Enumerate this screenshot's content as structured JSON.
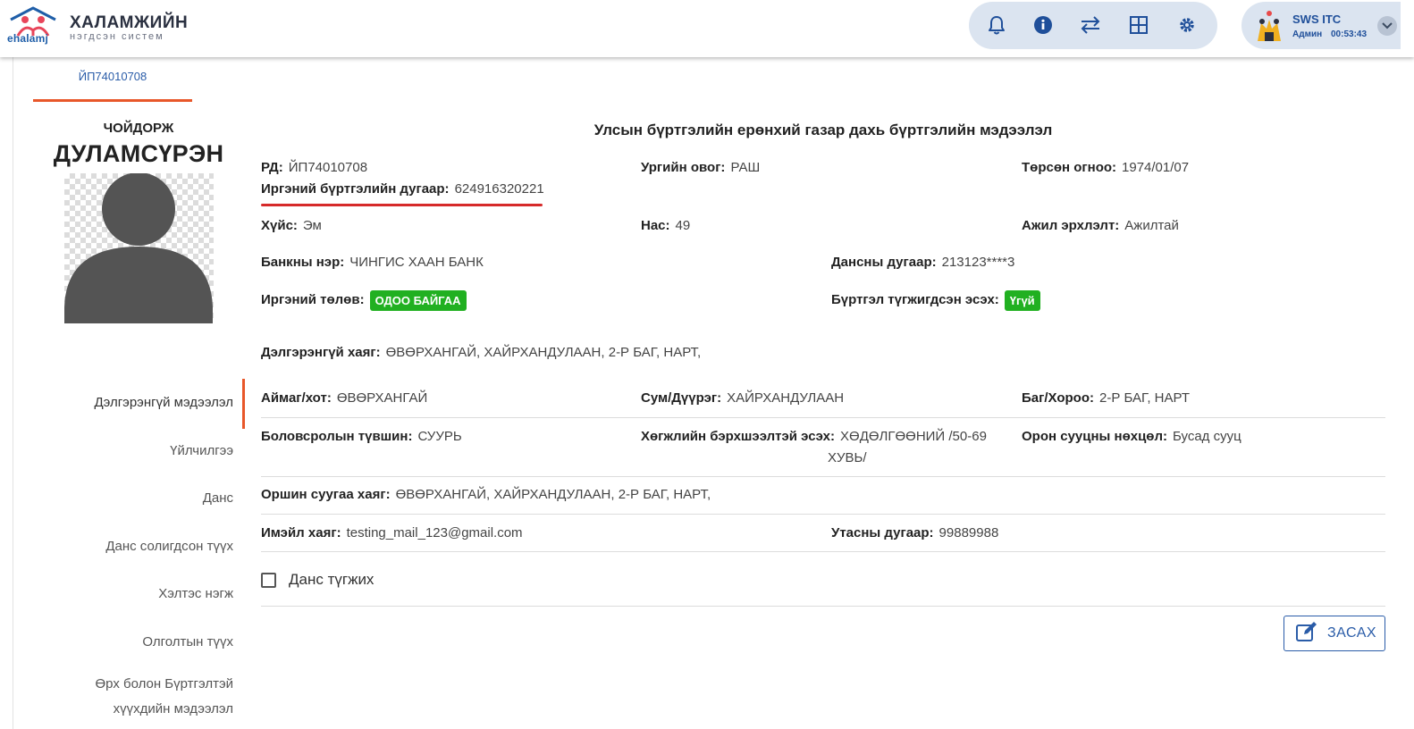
{
  "header": {
    "logo_text": "ehalamj",
    "brand_title": "ХАЛАМЖИЙН",
    "brand_subtitle": "нэгдсэн систем",
    "toolbar_icons": [
      "bell-icon",
      "info-icon",
      "transfer-icon",
      "grid-icon",
      "settings-icon"
    ],
    "user": {
      "name": "SWS ITC",
      "role": "Админ",
      "session_time": "00:53:43"
    },
    "colors": {
      "toolbar_bg": "#dbe4f0",
      "accent": "#1f4f9a"
    }
  },
  "tab": {
    "label": "ЙП74010708",
    "underline_color": "#e8572a"
  },
  "profile": {
    "first_name": "ЧОЙДОРЖ",
    "last_name": "ДУЛАМСҮРЭН"
  },
  "side_nav": {
    "items": [
      {
        "label": "Дэлгэрэнгүй мэдээлэл",
        "active": true
      },
      {
        "label": "Үйлчилгээ"
      },
      {
        "label": "Данс"
      },
      {
        "label": "Данс солигдсон түүх"
      },
      {
        "label": "Хэлтэс нэгж"
      },
      {
        "label": "Олголтын түүх"
      },
      {
        "label": "Өрх болон Бүртгэлтэй"
      },
      {
        "label": "хүүхдийн мэдээлэл"
      }
    ]
  },
  "main": {
    "section_title": "Улсын бүртгэлийн ерөнхий газар дахь бүртгэлийн мэдээлэл",
    "rd": {
      "label": "РД:",
      "value": "ЙП74010708"
    },
    "citizen_reg": {
      "label": "Иргэний бүртгэлийн дугаар:",
      "value": "624916320221"
    },
    "clan": {
      "label": "Ургийн овог:",
      "value": "РАШ"
    },
    "birth_date": {
      "label": "Төрсөн огноо:",
      "value": "1974/01/07"
    },
    "gender": {
      "label": "Хүйс:",
      "value": "Эм"
    },
    "age": {
      "label": "Нас:",
      "value": "49"
    },
    "employment": {
      "label": "Ажил эрхлэлт:",
      "value": "Ажилтай"
    },
    "bank_name": {
      "label": "Банкны нэр:",
      "value": "ЧИНГИС ХААН БАНК"
    },
    "account_no": {
      "label": "Дансны дугаар:",
      "value": "213123****3"
    },
    "citizen_status": {
      "label": "Иргэний төлөв:",
      "value": "ОДОО БАЙГАА"
    },
    "reg_suspended": {
      "label": "Бүртгэл түгжигдсэн эсэх:",
      "value": "Үгүй"
    },
    "full_address": {
      "label": "Дэлгэрэнгүй хаяг:",
      "value": "ӨВӨРХАНГАЙ, ХАЙРХАНДУЛААН, 2-Р БАГ, НАРТ,"
    },
    "province": {
      "label": "Аймаг/хот:",
      "value": "ӨВӨРХАНГАЙ"
    },
    "district": {
      "label": "Сум/Дүүрэг:",
      "value": "ХАЙРХАНДУЛААН"
    },
    "subdistrict": {
      "label": "Баг/Хороо:",
      "value": "2-Р БАГ, НАРТ"
    },
    "education": {
      "label": "Боловсролын түвшин:",
      "value": "СУУРЬ"
    },
    "disability": {
      "label": "Хөгжлийн бэрхшээлтэй эсэх:",
      "value_line1": "ХӨДӨЛГӨӨНИЙ /50-69",
      "value_line2": "ХУВЬ/"
    },
    "housing": {
      "label": "Орон сууцны нөхцөл:",
      "value": "Бусад сууц"
    },
    "residence": {
      "label": "Оршин суугаа хаяг:",
      "value": "ӨВӨРХАНГАЙ, ХАЙРХАНДУЛААН, 2-Р БАГ, НАРТ,"
    },
    "email": {
      "label": "Имэйл хаяг:",
      "value": "testing_mail_123@gmail.com"
    },
    "phone": {
      "label": "Утасны дугаар:",
      "value": "99889988"
    },
    "lock_account_label": "Данс түгжих",
    "edit_button_label": "ЗАСАХ",
    "colors": {
      "badge_green": "#21b021",
      "highlight_red": "#d62a2a"
    }
  }
}
